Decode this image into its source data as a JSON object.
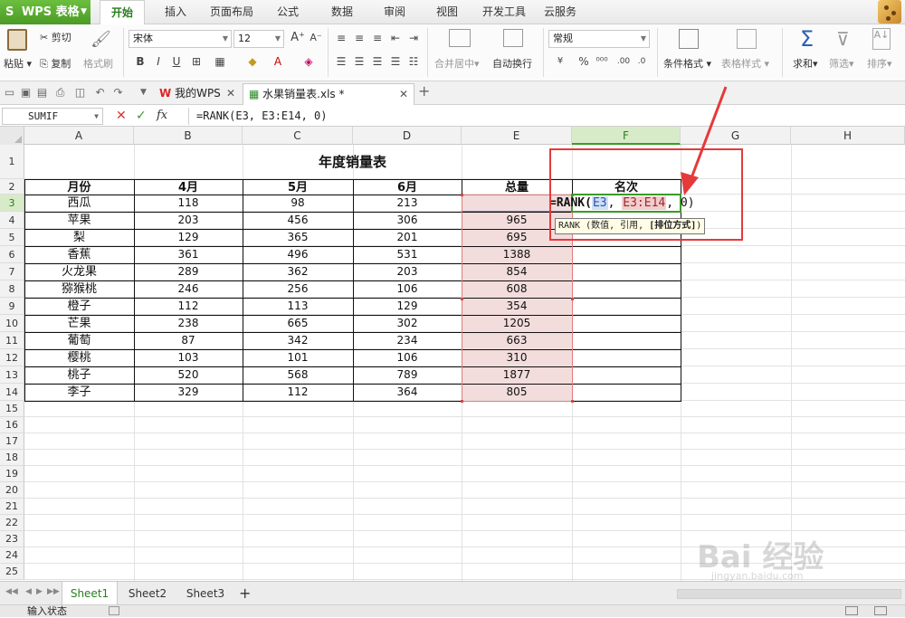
{
  "app": {
    "name": "WPS 表格"
  },
  "menu": [
    "开始",
    "插入",
    "页面布局",
    "公式",
    "数据",
    "审阅",
    "视图",
    "开发工具",
    "云服务"
  ],
  "ribbon": {
    "paste": "粘贴",
    "cut": "剪切",
    "copy": "复制",
    "format_painter": "格式刷",
    "font_name": "宋体",
    "font_size": "12",
    "merge_center": "合并居中",
    "wrap_text": "自动换行",
    "number_format": "常规",
    "conditional_format": "条件格式",
    "table_style": "表格样式",
    "sum": "求和",
    "filter": "筛选",
    "sort": "排序"
  },
  "doc_tabs": [
    "我的WPS",
    "水果销量表.xls *"
  ],
  "formula_bar": {
    "name_box": "SUMIF",
    "formula": "=RANK(E3, E3:E14, 0)"
  },
  "sheet": {
    "columns": [
      "A",
      "B",
      "C",
      "D",
      "E",
      "F",
      "G",
      "H"
    ],
    "rows": [
      "1",
      "2",
      "3",
      "4",
      "5",
      "6",
      "7",
      "8",
      "9",
      "10",
      "11",
      "12",
      "13",
      "14",
      "15",
      "16",
      "17",
      "18",
      "19",
      "20",
      "21",
      "22",
      "23",
      "24",
      "25"
    ],
    "title": "年度销量表",
    "headers": [
      "月份",
      "4月",
      "5月",
      "6月",
      "总量",
      "名次"
    ],
    "data": [
      [
        "西瓜",
        "118",
        "98",
        "213",
        "",
        ""
      ],
      [
        "苹果",
        "203",
        "456",
        "306",
        "965",
        ""
      ],
      [
        "梨",
        "129",
        "365",
        "201",
        "695",
        ""
      ],
      [
        "香蕉",
        "361",
        "496",
        "531",
        "1388",
        ""
      ],
      [
        "火龙果",
        "289",
        "362",
        "203",
        "854",
        ""
      ],
      [
        "猕猴桃",
        "246",
        "256",
        "106",
        "608",
        ""
      ],
      [
        "橙子",
        "112",
        "113",
        "129",
        "354",
        ""
      ],
      [
        "芒果",
        "238",
        "665",
        "302",
        "1205",
        ""
      ],
      [
        "葡萄",
        "87",
        "342",
        "234",
        "663",
        ""
      ],
      [
        "樱桃",
        "103",
        "101",
        "106",
        "310",
        ""
      ],
      [
        "桃子",
        "520",
        "568",
        "789",
        "1877",
        ""
      ],
      [
        "李子",
        "329",
        "112",
        "364",
        "805",
        ""
      ]
    ],
    "editing": {
      "prefix": "=RANK(",
      "ref1": "E3",
      "sep1": ", ",
      "ref2": "E3:E14",
      "tail": ", 0)"
    },
    "tooltip": {
      "text": "RANK (数值, 引用, ",
      "bold": "[排位方式]",
      "close": ")"
    }
  },
  "sheet_tabs": [
    "Sheet1",
    "Sheet2",
    "Sheet3"
  ],
  "status": "输入状态",
  "watermark": {
    "main": "Bai 经验",
    "sub": "jingyan.baidu.com"
  },
  "colors": {
    "accent": "#4a9a25",
    "highlight_red": "#e53a3a",
    "range_fill": "#f2dcdc"
  }
}
